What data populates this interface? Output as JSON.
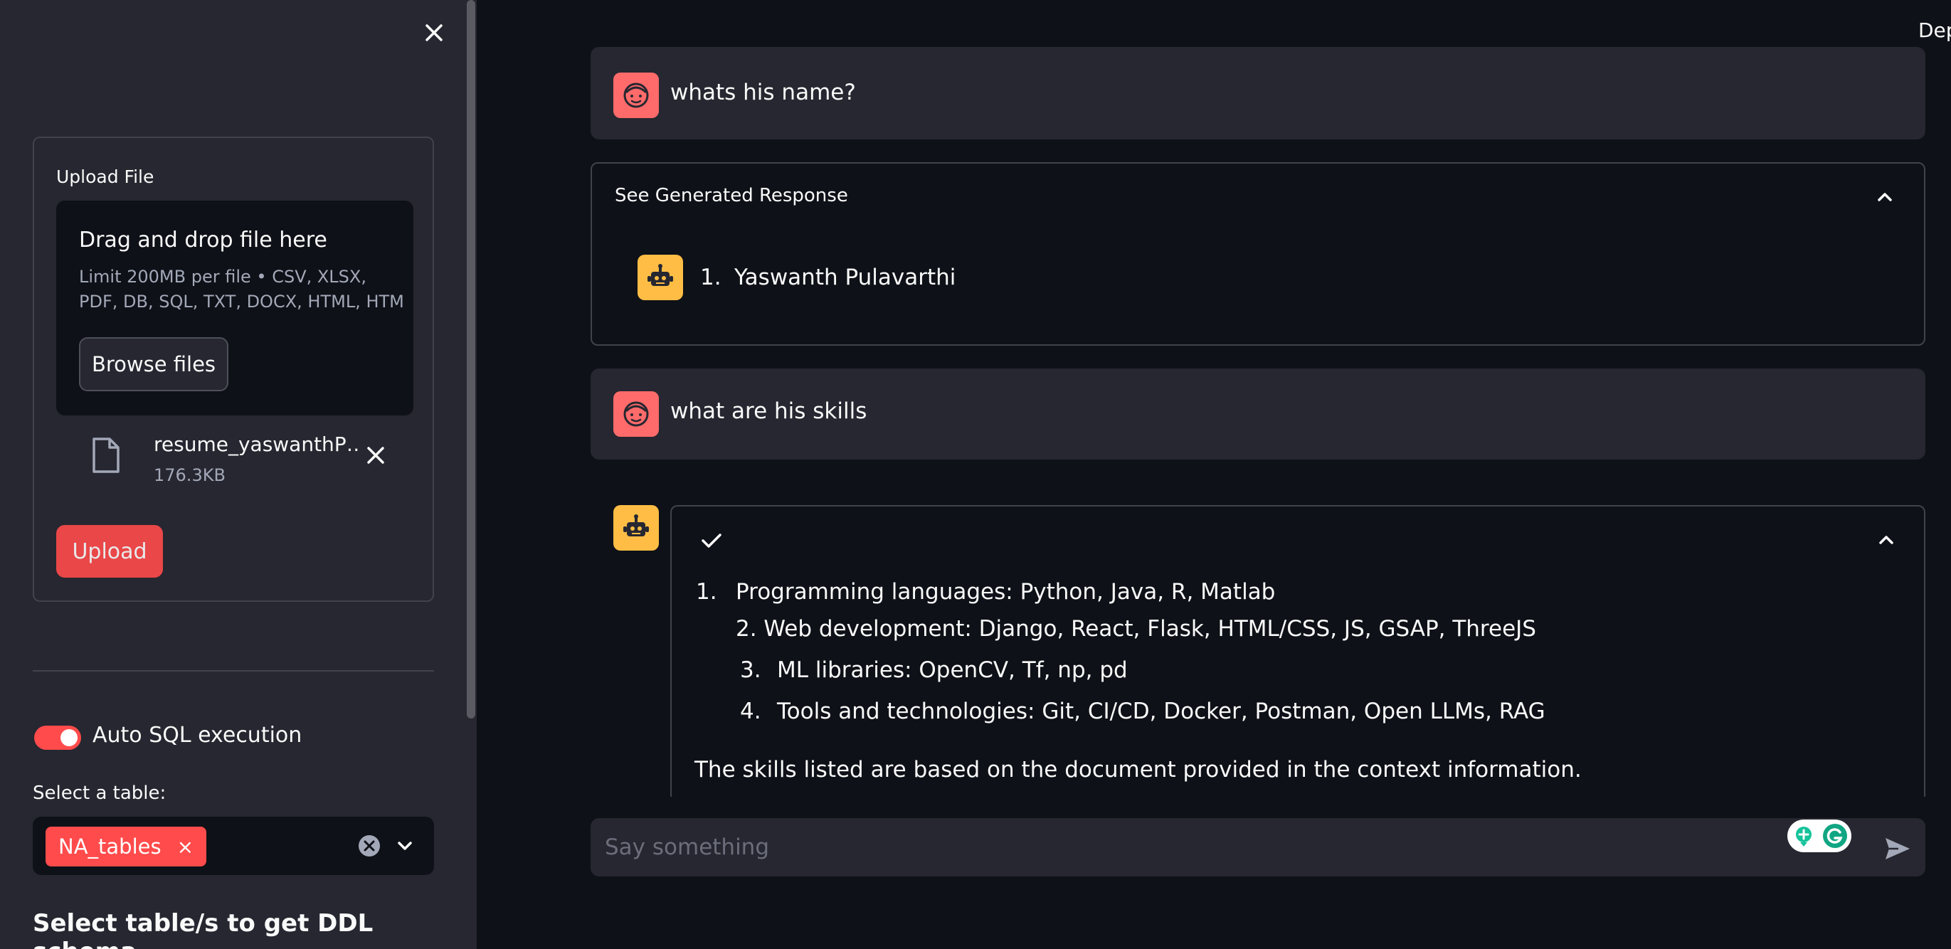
{
  "sidebar": {
    "upload": {
      "title": "Upload File",
      "dropzone_title": "Drag and drop file here",
      "dropzone_limit": "Limit 200MB per file • CSV, XLSX, PDF, DB, SQL, TXT, DOCX, HTML, HTM",
      "browse_label": "Browse files",
      "file_name": "resume_yaswanthP…",
      "file_size": "176.3KB",
      "upload_label": "Upload"
    },
    "toggle": {
      "label": "Auto SQL execution",
      "on": true
    },
    "select": {
      "label": "Select a table:",
      "selected": [
        "NA_tables"
      ]
    },
    "ddl_heading": "Select table/s to get DDL schema"
  },
  "main": {
    "top_right_text": "Dep",
    "messages": {
      "user_1": "whats his name?",
      "expander_1_title": "See Generated Response",
      "bot_1_number": "1.",
      "bot_1_text": "Yaswanth Pulavarthi",
      "user_2": "what are his skills",
      "bot_2": {
        "items": [
          {
            "num": "1.",
            "text": "Programming languages: Python, Java, R, Matlab"
          },
          {
            "num": "",
            "text": "2. Web development: Django, React, Flask, HTML/CSS, JS, GSAP, ThreeJS"
          },
          {
            "num": "3.",
            "text": "ML libraries: OpenCV, Tf, np, pd"
          },
          {
            "num": "4.",
            "text": "Tools and technologies: Git, CI/CD, Docker, Postman, Open LLMs, RAG"
          }
        ],
        "footer": "The skills listed are based on the document provided in the context information."
      }
    },
    "chat_input": {
      "placeholder": "Say something"
    }
  },
  "colors": {
    "sidebar_bg": "#262730",
    "main_bg": "#0e1117",
    "accent": "#ff4b4b",
    "user_avatar": "#ff6b6b",
    "bot_avatar": "#ffbd45"
  }
}
